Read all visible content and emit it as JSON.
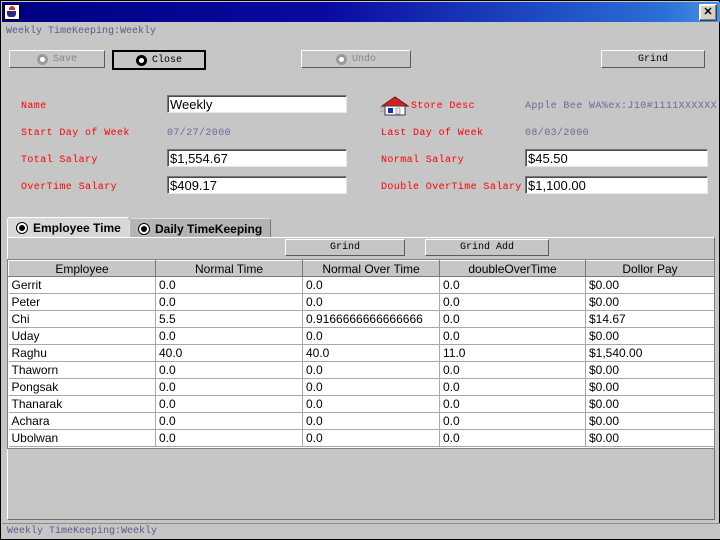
{
  "window": {
    "title": "",
    "icon": "coffee-cup-icon",
    "close_label": "✕",
    "subcaption": "Weekly TimeKeeping:Weekly",
    "statusbar": "Weekly TimeKeeping:Weekly"
  },
  "toolbar": {
    "save_label": "Save",
    "close_label": "Close",
    "undo_label": "Undo",
    "grind_label": "Grind"
  },
  "form": {
    "left": {
      "name_label": "Name",
      "name_value": "Weekly",
      "start_day_label": "Start Day of Week",
      "start_day_value": "07/27/2000",
      "total_salary_label": "Total Salary",
      "total_salary_value": "$1,554.67",
      "overtime_salary_label": "OverTime Salary",
      "overtime_salary_value": "$409.17"
    },
    "right": {
      "store_desc_label": "Store Desc",
      "store_desc_value": "Apple Bee WA%ex:J10#1111XXXXXX",
      "last_day_label": "Last Day of Week",
      "last_day_value": "08/03/2000",
      "normal_salary_label": "Normal Salary",
      "normal_salary_value": "$45.50",
      "double_overtime_label": "Double OverTime Salary",
      "double_overtime_value": "$1,100.00"
    }
  },
  "tabs": [
    {
      "label": "Employee Time",
      "active": true
    },
    {
      "label": "Daily TimeKeeping",
      "active": false
    }
  ],
  "panel_buttons": {
    "grind_label": "Grind",
    "grind_add_label": "Grind Add"
  },
  "table": {
    "columns": [
      "Employee",
      "Normal Time",
      "Normal Over Time",
      "doubleOverTime",
      "Dollor Pay"
    ],
    "rows": [
      [
        "Gerrit",
        "0.0",
        "0.0",
        "0.0",
        "$0.00"
      ],
      [
        "Peter",
        "0.0",
        "0.0",
        "0.0",
        "$0.00"
      ],
      [
        "Chi",
        "5.5",
        "0.9166666666666666",
        "0.0",
        "$14.67"
      ],
      [
        "Uday",
        "0.0",
        "0.0",
        "0.0",
        "$0.00"
      ],
      [
        "Raghu",
        "40.0",
        "40.0",
        "11.0",
        "$1,540.00"
      ],
      [
        "Thaworn",
        "0.0",
        "0.0",
        "0.0",
        "$0.00"
      ],
      [
        "Pongsak",
        "0.0",
        "0.0",
        "0.0",
        "$0.00"
      ],
      [
        "Thanarak",
        "0.0",
        "0.0",
        "0.0",
        "$0.00"
      ],
      [
        "Achara",
        "0.0",
        "0.0",
        "0.0",
        "$0.00"
      ],
      [
        "Ubolwan",
        "0.0",
        "0.0",
        "0.0",
        "$0.00"
      ]
    ]
  },
  "colors": {
    "label_red": "#ff0000",
    "readonly_blue": "#6a6a9a",
    "titlebar_blue": "#000082",
    "face": "#c6c6c6"
  }
}
